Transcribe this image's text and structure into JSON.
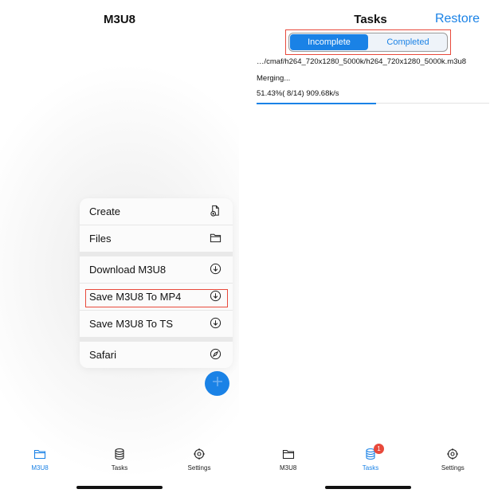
{
  "left": {
    "title": "M3U8",
    "menu": {
      "group1": [
        {
          "label": "Create",
          "icon": "document-add-icon"
        },
        {
          "label": "Files",
          "icon": "folder-icon"
        }
      ],
      "group2": [
        {
          "label": "Download M3U8",
          "icon": "download-circle-icon"
        },
        {
          "label": "Save M3U8 To MP4",
          "icon": "download-circle-icon"
        },
        {
          "label": "Save M3U8 To TS",
          "icon": "download-circle-icon"
        }
      ],
      "group3": [
        {
          "label": "Safari",
          "icon": "compass-icon"
        }
      ]
    },
    "fab_icon": "plus-icon",
    "tabs": [
      {
        "label": "M3U8",
        "icon": "folder-icon",
        "active": true
      },
      {
        "label": "Tasks",
        "icon": "database-icon",
        "active": false
      },
      {
        "label": "Settings",
        "icon": "gear-icon",
        "active": false
      }
    ]
  },
  "right": {
    "title": "Tasks",
    "restore_label": "Restore",
    "segments": [
      "Incomplete",
      "Completed"
    ],
    "task": {
      "path": "…/cmaf/h264_720x1280_5000k/h264_720x1280_5000k.m3u8",
      "status": "Merging...",
      "progress_text": "51.43%( 8/14) 909.68k/s",
      "progress_fraction": 0.5143
    },
    "tabs": [
      {
        "label": "M3U8",
        "icon": "folder-icon",
        "active": false
      },
      {
        "label": "Tasks",
        "icon": "database-icon",
        "active": true,
        "badge": "1"
      },
      {
        "label": "Settings",
        "icon": "gear-icon",
        "active": false
      }
    ]
  },
  "colors": {
    "accent": "#1a82e6",
    "highlight": "#e8493b",
    "badge": "#e8493b"
  }
}
